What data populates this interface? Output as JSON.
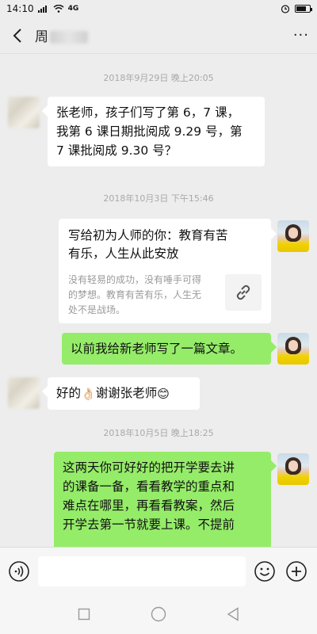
{
  "status_bar": {
    "time": "14:10",
    "network": "4G",
    "battery_level": 0.75
  },
  "header": {
    "contact_name_visible": "周",
    "more_label": "···"
  },
  "messages": [
    {
      "type": "time",
      "text": "2018年9月29日 晚上20:05"
    },
    {
      "type": "text",
      "side": "left",
      "lines": [
        "张老师，孩子们写了第 6，7 课，",
        "我第 6 课日期批阅成 9.29 号，第",
        "7 课批阅成 9.30 号？"
      ]
    },
    {
      "type": "time",
      "text": "2018年10月3日 下午15:46"
    },
    {
      "type": "link_card",
      "side": "right",
      "title_lines": [
        "写给初为人师的你：教育有苦",
        "有乐，人生从此安放"
      ],
      "desc_lines": [
        "没有轻易的成功，没有唾手可得",
        "的梦想。教育有苦有乐，人生无",
        "处不是战场。"
      ]
    },
    {
      "type": "text",
      "side": "right",
      "lines": [
        "以前我给新老师写了一篇文章。"
      ]
    },
    {
      "type": "text",
      "side": "left",
      "before": "好的",
      "emoji1": "👌🏻",
      "middle": "谢谢张老师",
      "emoji2": "😊"
    },
    {
      "type": "time",
      "text": "2018年10月5日 晚上18:25"
    },
    {
      "type": "text",
      "side": "right",
      "lines": [
        "这两天你可好好的把开学要去讲",
        "的课备一备，看看教学的重点和",
        "难点在哪里，再看看教案，然后",
        "开学去第一节就要上课。不提前"
      ]
    }
  ],
  "input": {
    "placeholder": ""
  },
  "icons": {
    "voice": "voice-icon",
    "emoji": "emoji-icon",
    "plus": "plus-icon",
    "link": "link-icon"
  },
  "colors": {
    "background": "#ededed",
    "self_bubble": "#95ec69",
    "other_bubble": "#ffffff",
    "timestamp": "#a9a9a9"
  }
}
